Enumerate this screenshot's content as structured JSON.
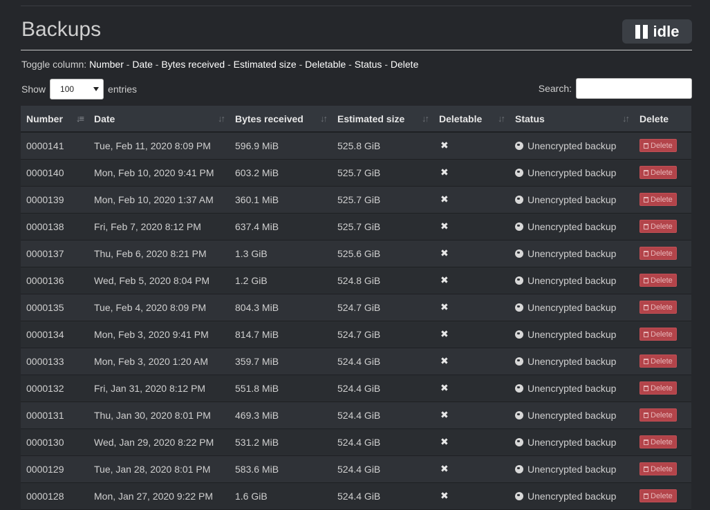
{
  "header": {
    "title": "Backups",
    "status_label": "idle"
  },
  "toggle": {
    "prefix": "Toggle column:",
    "columns": [
      "Number",
      "Date",
      "Bytes received",
      "Estimated size",
      "Deletable",
      "Status",
      "Delete"
    ]
  },
  "controls": {
    "show_label": "Show",
    "entries_value": "100",
    "entries_label": "entries",
    "search_label": "Search:",
    "search_value": ""
  },
  "table": {
    "headers": [
      "Number",
      "Date",
      "Bytes received",
      "Estimated size",
      "Deletable",
      "Status",
      "Delete"
    ],
    "rows": [
      {
        "number": "0000141",
        "date": "Tue, Feb 11, 2020 8:09 PM",
        "bytes": "596.9 MiB",
        "size": "525.8 GiB",
        "deletable": "✖",
        "status": "Unencrypted backup",
        "delete": "Delete"
      },
      {
        "number": "0000140",
        "date": "Mon, Feb 10, 2020 9:41 PM",
        "bytes": "603.2 MiB",
        "size": "525.7 GiB",
        "deletable": "✖",
        "status": "Unencrypted backup",
        "delete": "Delete"
      },
      {
        "number": "0000139",
        "date": "Mon, Feb 10, 2020 1:37 AM",
        "bytes": "360.1 MiB",
        "size": "525.7 GiB",
        "deletable": "✖",
        "status": "Unencrypted backup",
        "delete": "Delete"
      },
      {
        "number": "0000138",
        "date": "Fri, Feb 7, 2020 8:12 PM",
        "bytes": "637.4 MiB",
        "size": "525.7 GiB",
        "deletable": "✖",
        "status": "Unencrypted backup",
        "delete": "Delete"
      },
      {
        "number": "0000137",
        "date": "Thu, Feb 6, 2020 8:21 PM",
        "bytes": "1.3 GiB",
        "size": "525.6 GiB",
        "deletable": "✖",
        "status": "Unencrypted backup",
        "delete": "Delete"
      },
      {
        "number": "0000136",
        "date": "Wed, Feb 5, 2020 8:04 PM",
        "bytes": "1.2 GiB",
        "size": "524.8 GiB",
        "deletable": "✖",
        "status": "Unencrypted backup",
        "delete": "Delete"
      },
      {
        "number": "0000135",
        "date": "Tue, Feb 4, 2020 8:09 PM",
        "bytes": "804.3 MiB",
        "size": "524.7 GiB",
        "deletable": "✖",
        "status": "Unencrypted backup",
        "delete": "Delete"
      },
      {
        "number": "0000134",
        "date": "Mon, Feb 3, 2020 9:41 PM",
        "bytes": "814.7 MiB",
        "size": "524.7 GiB",
        "deletable": "✖",
        "status": "Unencrypted backup",
        "delete": "Delete"
      },
      {
        "number": "0000133",
        "date": "Mon, Feb 3, 2020 1:20 AM",
        "bytes": "359.7 MiB",
        "size": "524.4 GiB",
        "deletable": "✖",
        "status": "Unencrypted backup",
        "delete": "Delete"
      },
      {
        "number": "0000132",
        "date": "Fri, Jan 31, 2020 8:12 PM",
        "bytes": "551.8 MiB",
        "size": "524.4 GiB",
        "deletable": "✖",
        "status": "Unencrypted backup",
        "delete": "Delete"
      },
      {
        "number": "0000131",
        "date": "Thu, Jan 30, 2020 8:01 PM",
        "bytes": "469.3 MiB",
        "size": "524.4 GiB",
        "deletable": "✖",
        "status": "Unencrypted backup",
        "delete": "Delete"
      },
      {
        "number": "0000130",
        "date": "Wed, Jan 29, 2020 8:22 PM",
        "bytes": "531.2 MiB",
        "size": "524.4 GiB",
        "deletable": "✖",
        "status": "Unencrypted backup",
        "delete": "Delete"
      },
      {
        "number": "0000129",
        "date": "Tue, Jan 28, 2020 8:01 PM",
        "bytes": "583.6 MiB",
        "size": "524.4 GiB",
        "deletable": "✖",
        "status": "Unencrypted backup",
        "delete": "Delete"
      },
      {
        "number": "0000128",
        "date": "Mon, Jan 27, 2020 9:22 PM",
        "bytes": "1.6 GiB",
        "size": "524.4 GiB",
        "deletable": "✖",
        "status": "Unencrypted backup",
        "delete": "Delete"
      }
    ]
  }
}
